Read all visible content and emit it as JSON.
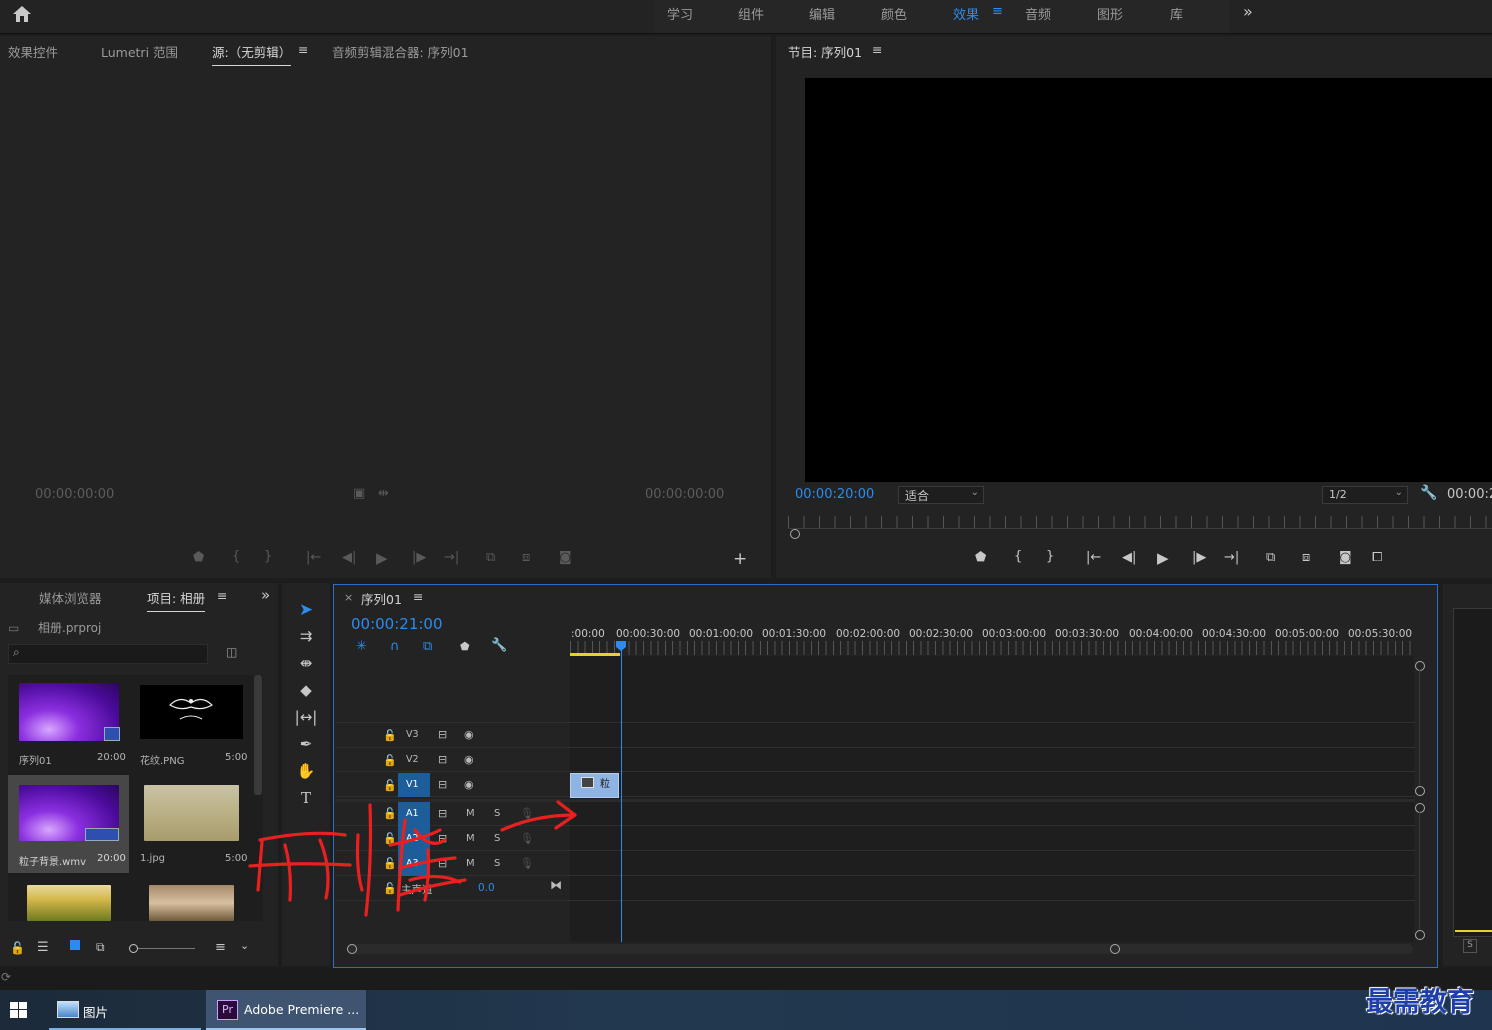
{
  "workspace": {
    "tabs": [
      "学习",
      "组件",
      "编辑",
      "颜色",
      "效果",
      "音频",
      "图形",
      "库"
    ],
    "active_tab": "效果",
    "more": "»"
  },
  "source_panel": {
    "tabs": [
      "效果控件",
      "Lumetri 范围",
      "源:（无剪辑）",
      "音频剪辑混合器: 序列01"
    ],
    "active_tab": "源:（无剪辑）",
    "timecode_left": "00:00:00:00",
    "timecode_right": "00:00:00:00"
  },
  "program_panel": {
    "title": "节目: 序列01",
    "timecode": "00:00:20:00",
    "fit_select": "适合",
    "resolution_select": "1/2",
    "timecode_right": "00:00:2"
  },
  "project_panel": {
    "tabs": [
      "媒体浏览器",
      "项目: 相册"
    ],
    "active_tab": "项目: 相册",
    "project_file": "相册.prproj",
    "items": [
      {
        "name": "序列01",
        "duration": "20:00",
        "thumb": "purple-sequence"
      },
      {
        "name": "花纹.PNG",
        "duration": "5:00",
        "thumb": "ornament"
      },
      {
        "name": "粒子背景.wmv",
        "duration": "20:00",
        "thumb": "purple-particles"
      },
      {
        "name": "1.jpg",
        "duration": "5:00",
        "thumb": "beach-love"
      },
      {
        "name": "",
        "duration": "",
        "thumb": "sunflower-girl"
      },
      {
        "name": "",
        "duration": "",
        "thumb": "couple"
      }
    ]
  },
  "timeline": {
    "title": "序列01",
    "timecode": "00:00:21:00",
    "ruler": [
      ":00:00",
      "00:00:30:00",
      "00:01:00:00",
      "00:01:30:00",
      "00:02:00:00",
      "00:02:30:00",
      "00:03:00:00",
      "00:03:30:00",
      "00:04:00:00",
      "00:04:30:00",
      "00:05:00:00",
      "00:05:30:00"
    ],
    "tracks": [
      {
        "id": "V3",
        "type": "video"
      },
      {
        "id": "V2",
        "type": "video"
      },
      {
        "id": "V1",
        "type": "video"
      },
      {
        "id": "A1",
        "type": "audio",
        "m": "M",
        "s": "S"
      },
      {
        "id": "A2",
        "type": "audio",
        "m": "M",
        "s": "S"
      },
      {
        "id": "A3",
        "type": "audio",
        "m": "M",
        "s": "S"
      }
    ],
    "master_label": "主声道",
    "master_value": "0.0",
    "clip_label": "粒"
  },
  "annotation": {
    "handwritten": "删掉",
    "color": "#e82020"
  },
  "taskbar": {
    "items": [
      {
        "label": "图片"
      },
      {
        "label": "Adobe Premiere ..."
      }
    ]
  },
  "watermark": "最需教育",
  "colors": {
    "accent": "#2d8ceb",
    "panel": "#232323",
    "clip": "#8fb4e3",
    "annotation": "#e82020"
  }
}
